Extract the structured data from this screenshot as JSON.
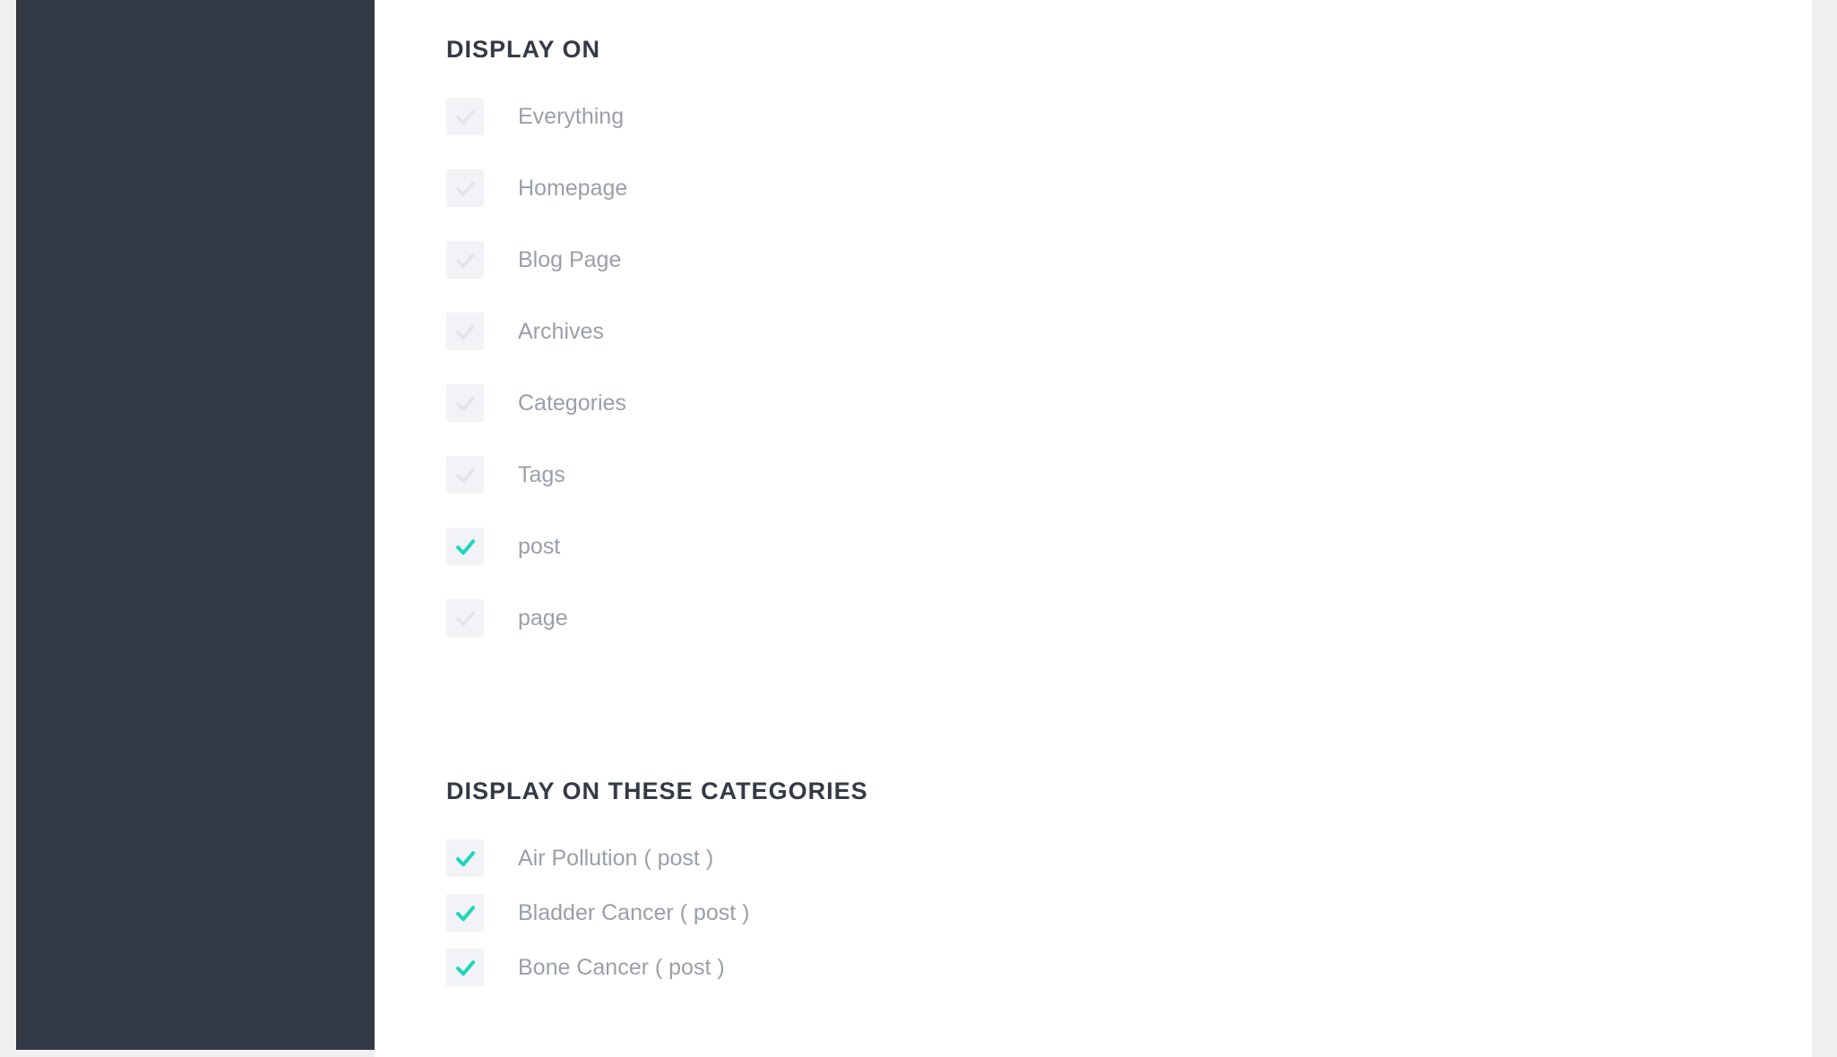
{
  "theme": {
    "sidebar_bg": "#343a45",
    "panel_bg": "#ffffff",
    "page_bg": "#f0f0f0",
    "checkbox_bg": "#f2f3f7",
    "checked_color": "#1ed6bb",
    "unchecked_color": "#e2e4e9",
    "label_color": "#9aa0a8",
    "heading_color": "#343a45"
  },
  "display_on": {
    "title": "DISPLAY ON",
    "items": [
      {
        "label": "Everything",
        "checked": false,
        "icon": "check-icon"
      },
      {
        "label": "Homepage",
        "checked": false,
        "icon": "check-icon"
      },
      {
        "label": "Blog Page",
        "checked": false,
        "icon": "check-icon"
      },
      {
        "label": "Archives",
        "checked": false,
        "icon": "check-icon"
      },
      {
        "label": "Categories",
        "checked": false,
        "icon": "check-icon"
      },
      {
        "label": "Tags",
        "checked": false,
        "icon": "check-icon"
      },
      {
        "label": "post",
        "checked": true,
        "icon": "check-icon"
      },
      {
        "label": "page",
        "checked": false,
        "icon": "check-icon"
      }
    ]
  },
  "display_on_categories": {
    "title": "DISPLAY ON THESE CATEGORIES",
    "items": [
      {
        "label": "Air Pollution ( post )",
        "checked": true,
        "icon": "check-icon"
      },
      {
        "label": "Bladder Cancer ( post )",
        "checked": true,
        "icon": "check-icon"
      },
      {
        "label": "Bone Cancer ( post )",
        "checked": true,
        "icon": "check-icon"
      }
    ]
  }
}
